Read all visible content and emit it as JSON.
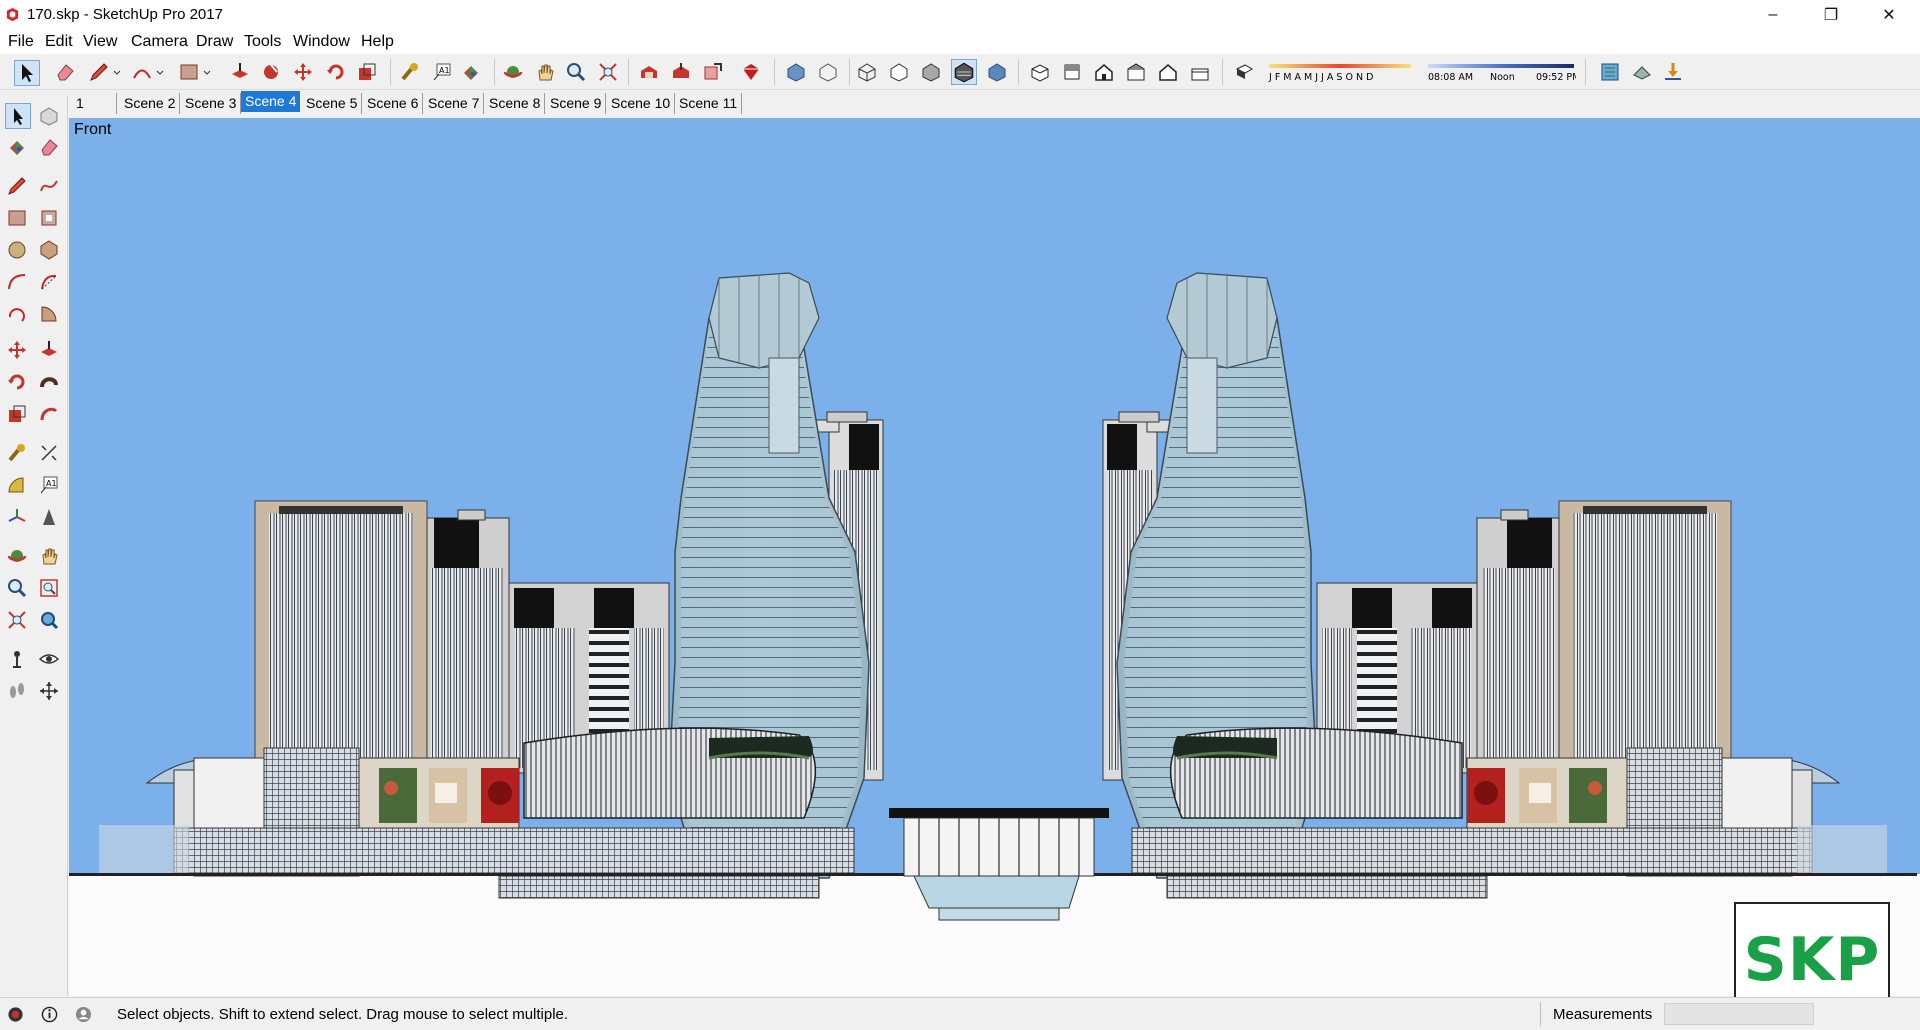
{
  "window": {
    "title": "170.skp - SketchUp Pro 2017",
    "minimize": "–",
    "restore": "❐",
    "close": "✕"
  },
  "menu": [
    "File",
    "Edit",
    "View",
    "Camera",
    "Draw",
    "Tools",
    "Window",
    "Help"
  ],
  "shadow_settings": {
    "months": "J F M A M J J A S O N D",
    "time_start": "08:08 AM",
    "time_mid": "Noon",
    "time_end": "09:52 PM"
  },
  "scenes": {
    "tabs": [
      "1",
      "Scene 2",
      "Scene 3",
      "Scene 4",
      "Scene 5",
      "Scene 6",
      "Scene 7",
      "Scene 8",
      "Scene 9",
      "Scene 10",
      "Scene 11"
    ],
    "active": "Scene 4"
  },
  "viewport": {
    "view_label": "Front",
    "sky_color": "#7bb0ea",
    "ground_color": "#fbfbfb"
  },
  "logo": {
    "text": "SKP",
    "color": "#1aa046"
  },
  "status": {
    "message": "Select objects. Shift to extend select. Drag mouse to select multiple.",
    "measurements_label": "Measurements",
    "measurements_value": ""
  },
  "colors": {
    "active_tab": "#1e78d6",
    "glass": "#a9c7d6",
    "frame": "#4c5866"
  }
}
